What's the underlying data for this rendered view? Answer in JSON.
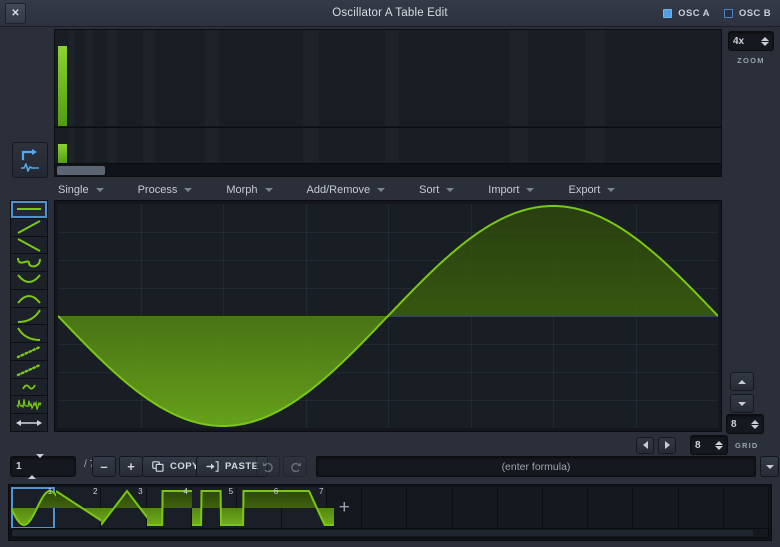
{
  "window": {
    "title": "Oscillator A Table Edit",
    "close_label": "✕"
  },
  "osc_toggles": [
    {
      "label": "OSC A",
      "active": true
    },
    {
      "label": "OSC B",
      "active": false
    }
  ],
  "zoom": {
    "value": "4x",
    "label": "ZOOM"
  },
  "spectrum": {
    "harmonic_magnitudes": [
      1.0
    ],
    "harmonic_phases": [
      0.55
    ]
  },
  "menu": [
    {
      "label": "Single"
    },
    {
      "label": "Process"
    },
    {
      "label": "Morph"
    },
    {
      "label": "Add/Remove"
    },
    {
      "label": "Sort"
    },
    {
      "label": "Import"
    },
    {
      "label": "Export"
    }
  ],
  "presets": [
    {
      "name": "flat-line",
      "selected": true
    },
    {
      "name": "ramp-up"
    },
    {
      "name": "ramp-down"
    },
    {
      "name": "s-curve"
    },
    {
      "name": "valley-curve"
    },
    {
      "name": "hill-curve"
    },
    {
      "name": "ease-in-curve"
    },
    {
      "name": "ease-out-curve"
    },
    {
      "name": "dotted-ramp-up"
    },
    {
      "name": "dotted-ramp-down"
    },
    {
      "name": "small-wave"
    },
    {
      "name": "noise"
    },
    {
      "name": "horizontal-resize"
    }
  ],
  "editor": {
    "grid_columns": 8,
    "grid_rows": 8,
    "waveform": "inverted-sine"
  },
  "grid_control": {
    "value": "8",
    "label": "GRID"
  },
  "vertical_control": {
    "value": "8"
  },
  "toolbar": {
    "frame_index": "1",
    "frame_total": "/ 7",
    "minus_label": "–",
    "plus_label": "+",
    "copy_label": "COPY",
    "paste_label": "PASTE",
    "undo_label": "undo",
    "redo_label": "redo",
    "formula_placeholder": "(enter formula)"
  },
  "frames": [
    {
      "number": "1",
      "shape": "sine",
      "selected": true
    },
    {
      "number": "2",
      "shape": "saw-down",
      "selected": false
    },
    {
      "number": "3",
      "shape": "triangle",
      "selected": false
    },
    {
      "number": "4",
      "shape": "pulse-wide",
      "selected": false
    },
    {
      "number": "5",
      "shape": "pulse-narrow",
      "selected": false
    },
    {
      "number": "6",
      "shape": "square",
      "selected": false
    },
    {
      "number": "7",
      "shape": "ramp-down",
      "selected": false
    }
  ],
  "add_frame_label": "+",
  "empty_slot_count": 9,
  "colors": {
    "accent_green": "#7ac816",
    "accent_blue": "#4e9ee0",
    "selection_blue": "#5295cf",
    "background": "#2b2f3a",
    "panel": "#191d24"
  }
}
